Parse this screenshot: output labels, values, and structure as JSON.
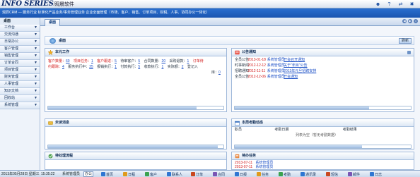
{
  "app": {
    "logo": "INFO SERIES",
    "logo_sub": "/观晨软件",
    "banner": "观辰CRM — 服务行业 标准化产品业务/事务管理业务 企业全面管理（市场、客户、销售、订单项目、财税、人事、协同办公一体化）"
  },
  "sidebar": {
    "heading": "桌面",
    "items": [
      {
        "label": "工作台"
      },
      {
        "label": "交流沟通"
      },
      {
        "label": "日常办公"
      },
      {
        "label": "客户管理"
      },
      {
        "label": "销售管理"
      },
      {
        "label": "订单合同"
      },
      {
        "label": "项目管理"
      },
      {
        "label": "财务管理"
      },
      {
        "label": "人事管理"
      },
      {
        "label": "知识文档"
      },
      {
        "label": "回收站"
      },
      {
        "label": "系统管理"
      }
    ]
  },
  "tabs": {
    "active": "桌面"
  },
  "page": {
    "title": "桌面",
    "refresh_label": "刷新"
  },
  "panels": {
    "work": {
      "title": "本元工作",
      "row1": [
        {
          "label": "客户数量：",
          "value": "60"
        },
        {
          "label": "项目任务：",
          "value": "1"
        },
        {
          "label": "客户跟进：",
          "value": "5"
        },
        {
          "label": "待审客户：",
          "value": "5"
        },
        {
          "label": "合同数量：",
          "value": "20"
        },
        {
          "label": "采购退款：",
          "value": "1"
        },
        {
          "label": "订单待",
          "value": ""
        }
      ],
      "row2": [
        {
          "label": "约跟踪：",
          "value": "4"
        },
        {
          "label": "服务执行中：",
          "value": "25"
        },
        {
          "label": "报销执行：",
          "value": "1"
        },
        {
          "label": "付款执行：",
          "value": "5"
        },
        {
          "label": "收款执行：",
          "value": "1"
        },
        {
          "label": "实际额：",
          "value": "2"
        },
        {
          "label": "登记入",
          "value": ""
        }
      ],
      "row3": {
        "label": "库：",
        "value": "0"
      }
    },
    "notice": {
      "title": "公告通知",
      "items": [
        {
          "type": "全员公告",
          "date": "2013-01-18",
          "dept": "系统管理员",
          "title": "开会召开通知"
        },
        {
          "type": "时事新闻",
          "date": "2012-12-12",
          "dept": "系统管理员",
          "title": "关于“年目”公告"
        },
        {
          "type": "招聘通知",
          "date": "2012-11-11",
          "dept": "系统管理员",
          "title": "2013年元旦招聘安排"
        },
        {
          "type": "全员公告",
          "date": "2012-12-06",
          "dept": "系统管理员",
          "title": "开会通知"
        }
      ]
    },
    "unread": {
      "title": "未读消息"
    },
    "attendance": {
      "title": "本周考勤动态",
      "columns": [
        "职员",
        "考勤日期",
        "考勤结果"
      ],
      "empty": "列表为空（暂无考勤数据）"
    },
    "process": {
      "title": "待处理流程"
    },
    "tasks": {
      "title": "待办任务",
      "items": [
        {
          "date": "2013-07-11",
          "dept": "系统管理员"
        },
        {
          "date": "2013-07-11",
          "dept": "系统管理员"
        }
      ]
    }
  },
  "statusbar": {
    "datetime": "2013年05月28日 星期三",
    "time": "15:35:22",
    "user_label": "系统管理员",
    "user_select": "办公",
    "quick": [
      {
        "label": "首页",
        "color": "#2f76d2"
      },
      {
        "label": "日程",
        "color": "#e09a1c"
      },
      {
        "label": "客户",
        "color": "#3aa24f"
      },
      {
        "label": "联系人",
        "color": "#2f76d2"
      },
      {
        "label": "订单",
        "color": "#c9471f"
      },
      {
        "label": "合同",
        "color": "#7a55b4"
      },
      {
        "label": "日报",
        "color": "#2f76d2"
      },
      {
        "label": "任务",
        "color": "#e09a1c"
      },
      {
        "label": "考勤",
        "color": "#3aa24f"
      },
      {
        "label": "通讯录",
        "color": "#2f76d2"
      },
      {
        "label": "短信",
        "color": "#c9471f"
      },
      {
        "label": "邮件",
        "color": "#7a55b4"
      },
      {
        "label": "日志",
        "color": "#2f76d2"
      }
    ]
  },
  "icons": {
    "top": [
      "person-icon",
      "help-icon",
      "switch-icon",
      "exit-icon"
    ],
    "panel_work": "star-icon",
    "panel_notice": "bulletin-icon",
    "panel_unread": "message-icon",
    "panel_attendance": "calendar-icon",
    "panel_process": "flow-icon",
    "panel_tasks": "task-icon"
  }
}
